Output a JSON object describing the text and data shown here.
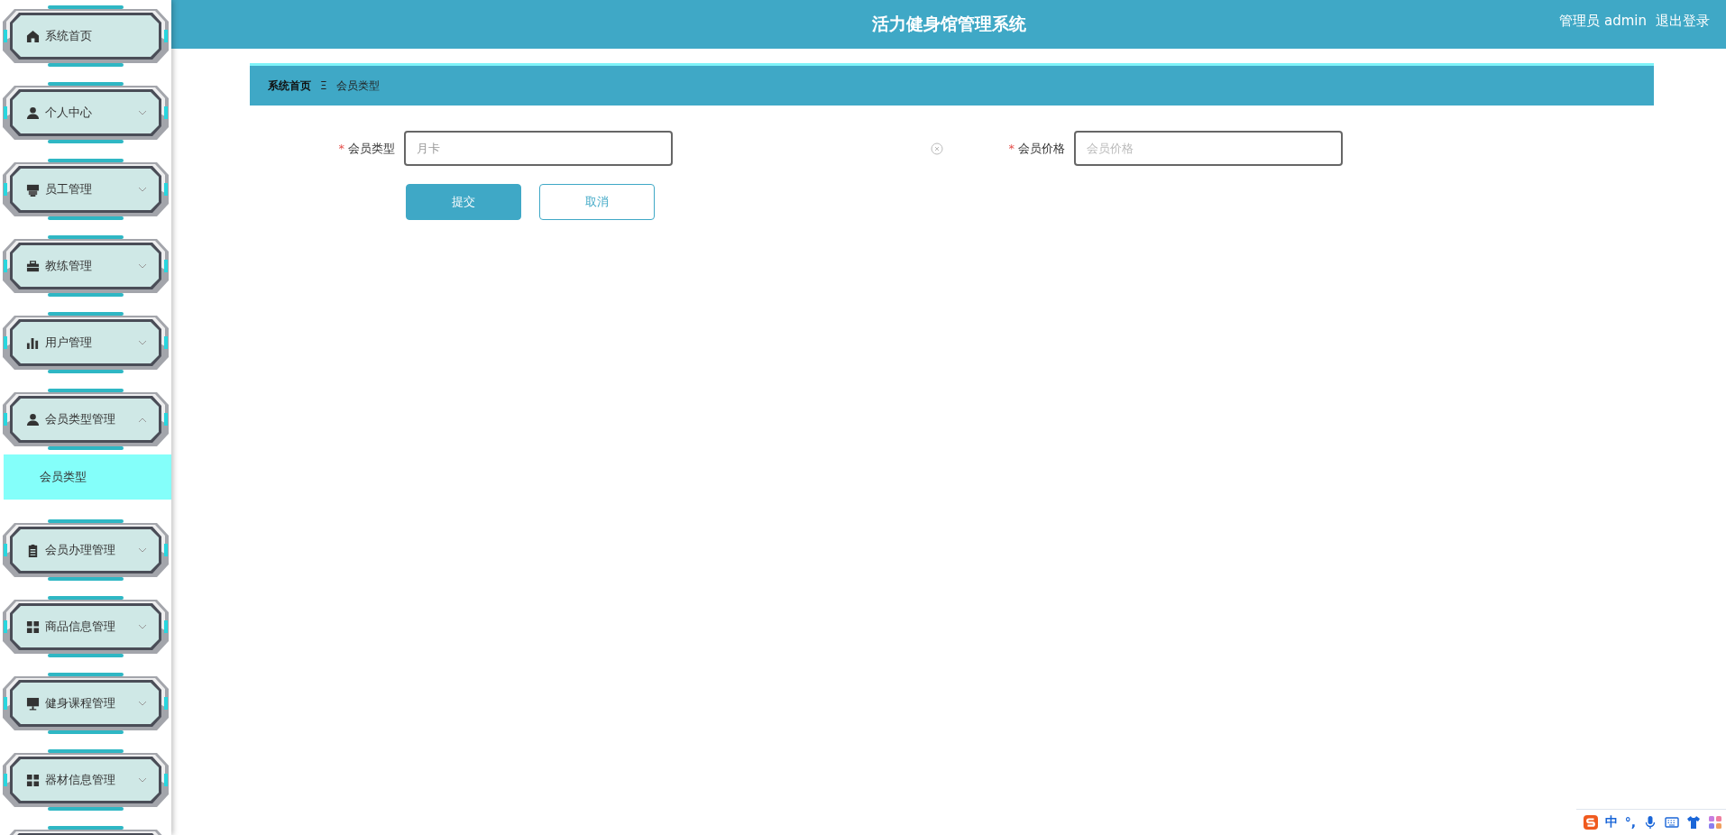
{
  "header": {
    "title": "活力健身馆管理系统",
    "user": "管理员 admin",
    "logout": "退出登录"
  },
  "sidebar": {
    "items": [
      {
        "label": "系统首页",
        "kind": "link"
      },
      {
        "label": "个人中心",
        "kind": "group",
        "expanded": false
      },
      {
        "label": "员工管理",
        "kind": "group",
        "expanded": false
      },
      {
        "label": "教练管理",
        "kind": "group",
        "expanded": false
      },
      {
        "label": "用户管理",
        "kind": "group",
        "expanded": false
      },
      {
        "label": "会员类型管理",
        "kind": "group",
        "expanded": true,
        "children": [
          {
            "label": "会员类型",
            "selected": true
          }
        ]
      },
      {
        "label": "会员办理管理",
        "kind": "group",
        "expanded": false
      },
      {
        "label": "商品信息管理",
        "kind": "group",
        "expanded": false
      },
      {
        "label": "健身课程管理",
        "kind": "group",
        "expanded": false
      },
      {
        "label": "器材信息管理",
        "kind": "group",
        "expanded": false
      }
    ]
  },
  "breadcrumb": {
    "items": [
      "系统首页",
      "会员类型"
    ],
    "separator": "Ξ"
  },
  "form": {
    "fields": [
      {
        "label": "会员类型",
        "required_mark": "*",
        "value": "月卡",
        "clearable": true
      },
      {
        "label": "会员价格",
        "required_mark": "*",
        "placeholder": "会员价格"
      }
    ],
    "buttons": [
      {
        "label": "提交",
        "kind": "primary"
      },
      {
        "label": "取消",
        "kind": "plain"
      }
    ]
  },
  "ime_bar": {
    "texts": [
      "中",
      "°,"
    ]
  }
}
